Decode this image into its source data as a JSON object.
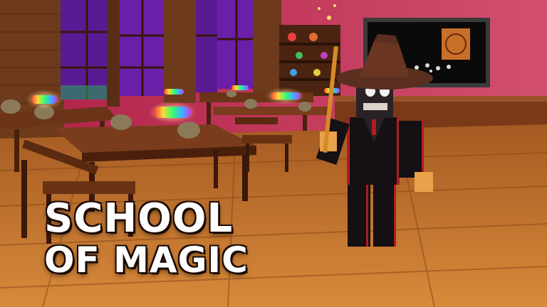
{
  "thumbnail": {
    "title_line_1": "SCHOOL",
    "title_line_2": "OF MAGIC"
  },
  "colors": {
    "wall_pink": "#c2305a",
    "window_purple": "#6a1fa8",
    "floor_wood": "#c8782e",
    "desk_wood": "#6b3418",
    "robe_black": "#141014",
    "robe_trim_red": "#b01c22",
    "hat_brown": "#5a2f1f",
    "skin": "#e9a24c",
    "title_text": "#ffffff"
  },
  "icons": [
    "wizard-hat-icon",
    "magic-wand-icon",
    "potion-bottle-icon",
    "rainbow-glow-icon"
  ]
}
